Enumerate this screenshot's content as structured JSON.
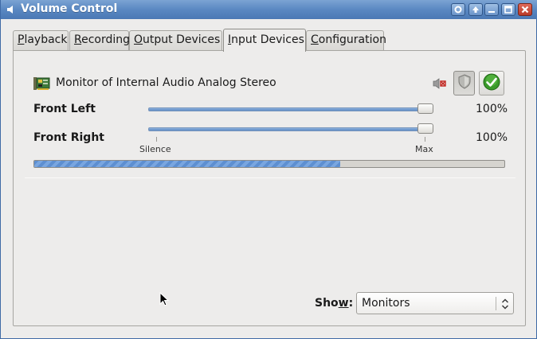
{
  "window": {
    "title": "Volume Control",
    "accent_color": "#5a88c2",
    "close_color": "#c0402f"
  },
  "titlebar_buttons": [
    "menu-icon",
    "shade-icon",
    "minimize-icon",
    "maximize-icon",
    "close-icon"
  ],
  "tabs": [
    {
      "label": "Playback",
      "mnemonic": "P",
      "rest": "layback",
      "active": false
    },
    {
      "label": "Recording",
      "mnemonic": "R",
      "rest": "ecording",
      "active": false
    },
    {
      "label": "Output Devices",
      "mnemonic": "O",
      "rest": "utput Devices",
      "active": false
    },
    {
      "label": "Input Devices",
      "mnemonic": "I",
      "rest": "nput Devices",
      "active": true
    },
    {
      "label": "Configuration",
      "mnemonic": "C",
      "rest": "onfiguration",
      "active": false
    }
  ],
  "device": {
    "name": "Monitor of Internal Audio Analog Stereo",
    "icon": "sound-card-icon",
    "mute_indicator": "speaker-muted-icon",
    "lock_button_icon": "shield-icon",
    "default_button_icon": "checkmark-icon"
  },
  "channels": [
    {
      "name": "Front Left",
      "value_text": "100%",
      "value": 100
    },
    {
      "name": "Front Right",
      "value_text": "100%",
      "value": 100
    }
  ],
  "scale": {
    "min_label": "Silence",
    "max_label": "Max"
  },
  "level_meter": {
    "value": 0.65
  },
  "show": {
    "label_mnemonic": "Sho",
    "label_underlined": "w",
    "label_suffix": ":",
    "selected": "Monitors"
  }
}
